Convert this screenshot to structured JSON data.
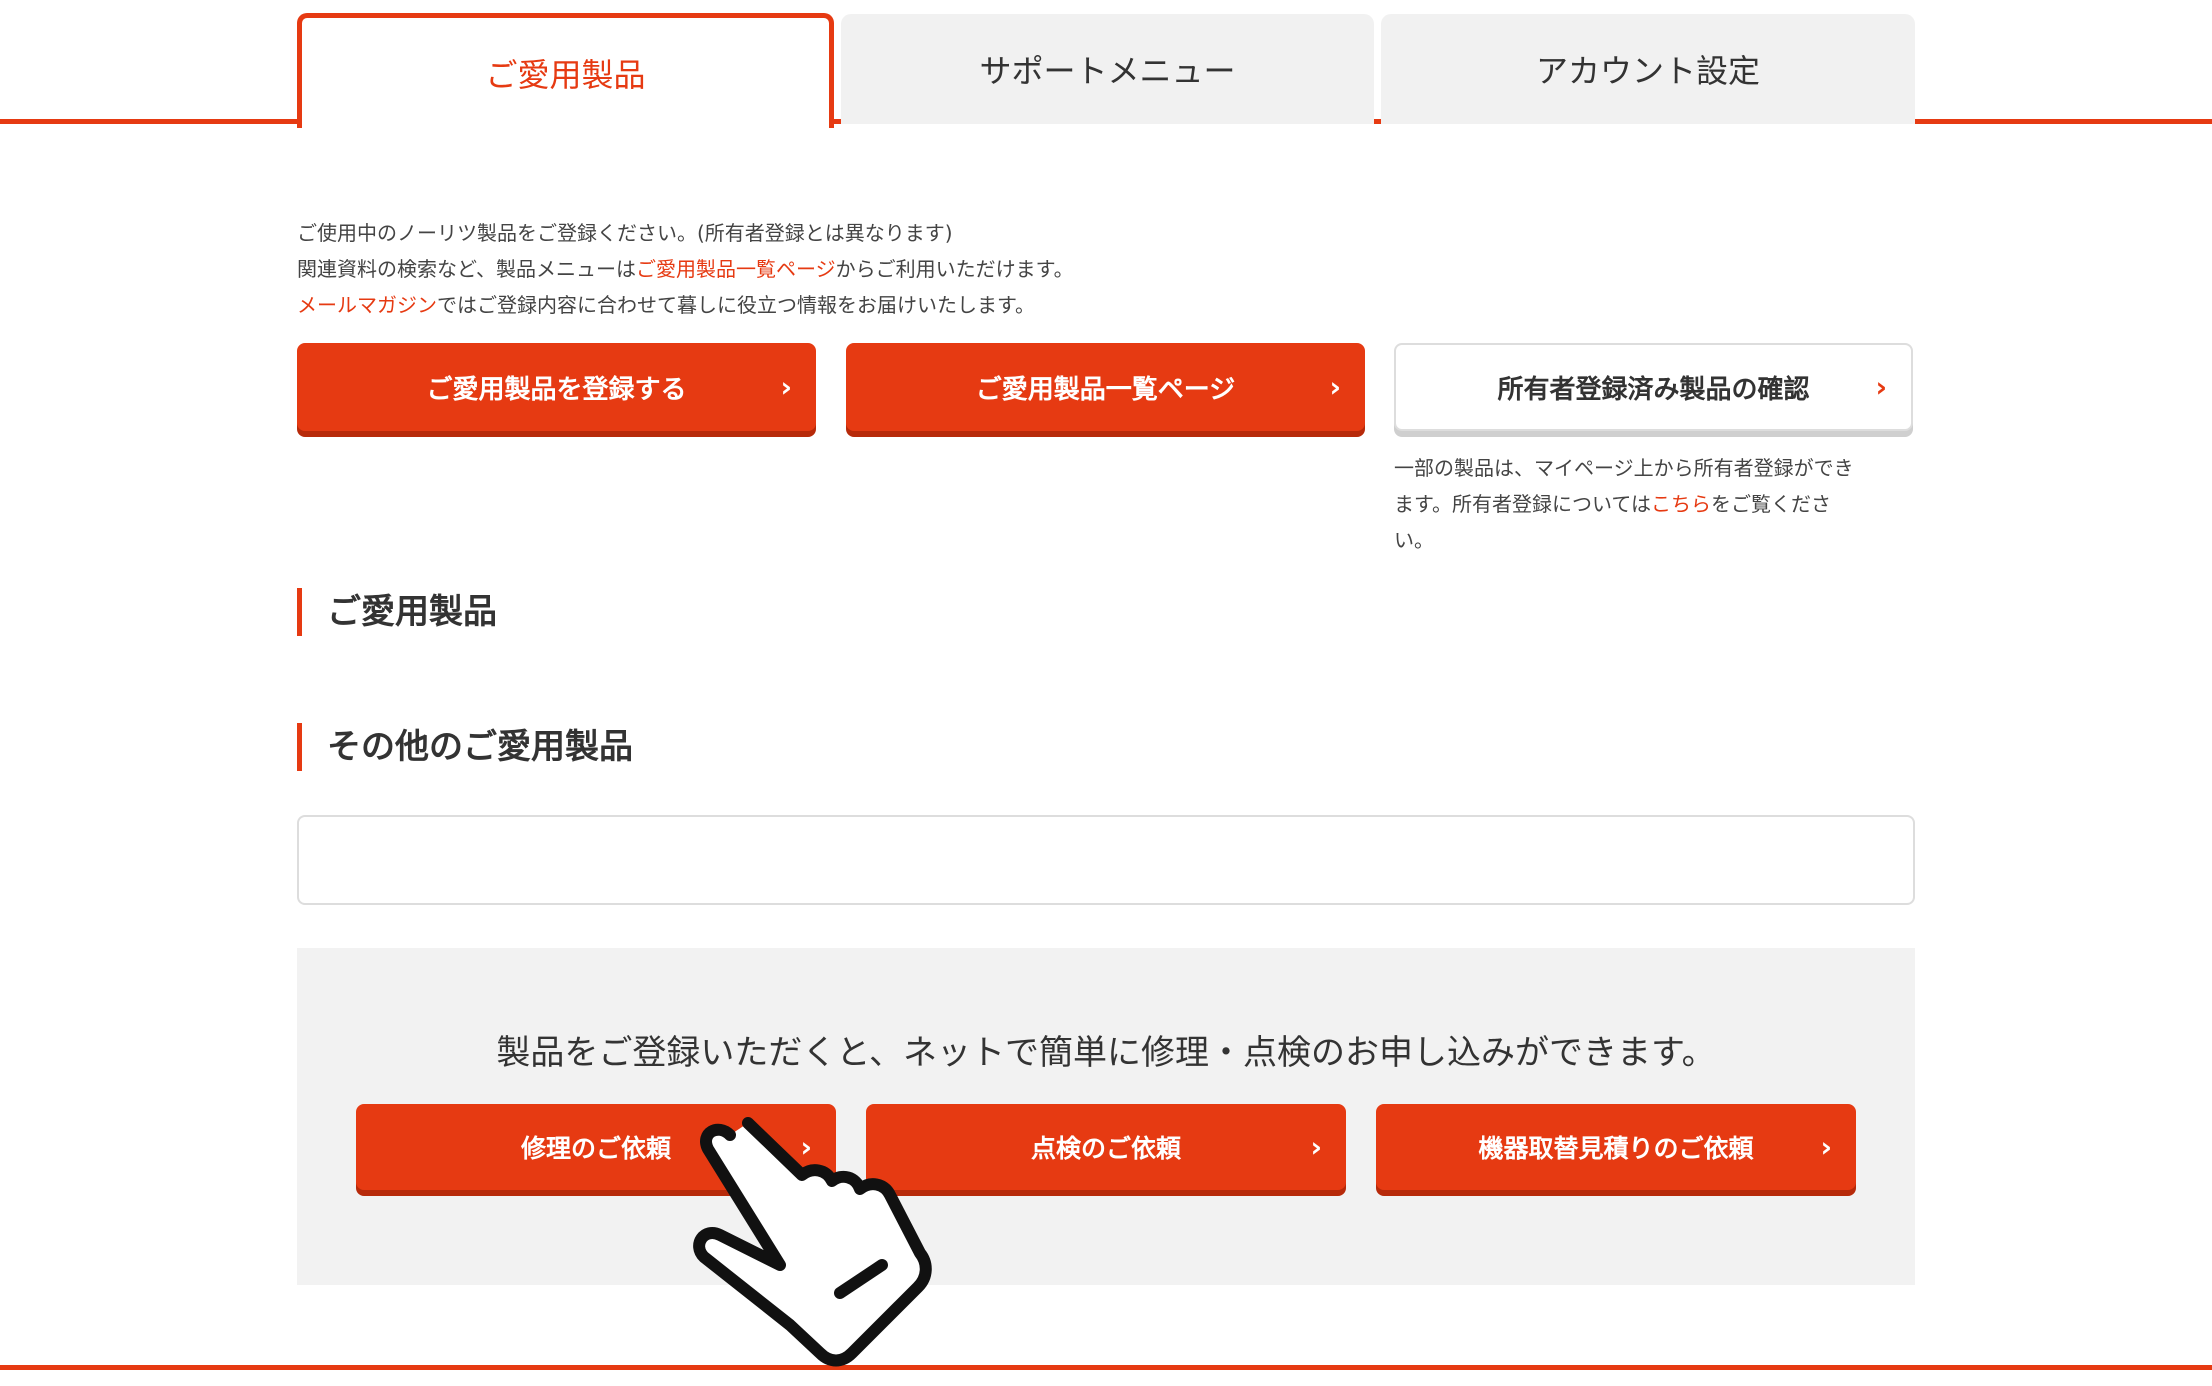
{
  "tabs": [
    {
      "label": "ご愛用製品",
      "active": true
    },
    {
      "label": "サポートメニュー",
      "active": false
    },
    {
      "label": "アカウント設定",
      "active": false
    }
  ],
  "intro": {
    "line1": "ご使用中のノーリツ製品をご登録ください。(所有者登録とは異なります)",
    "line2_pre": "関連資料の検索など、製品メニューは",
    "line2_link": "ご愛用製品一覧ページ",
    "line2_post": "からご利用いただけます。",
    "line3_link": "メールマガジン",
    "line3_post": "ではご登録内容に合わせて暮しに役立つ情報をお届けいたします。"
  },
  "buttons": {
    "register": "ご愛用製品を登録する",
    "list": "ご愛用製品一覧ページ",
    "owner_check": "所有者登録済み製品の確認",
    "chevron": "›"
  },
  "note": {
    "pre": "一部の製品は、マイページ上から所有者登録ができます。所有者登録については",
    "link": "こちら",
    "post": "をご覧ください。"
  },
  "sections": {
    "my_products": "ご愛用製品",
    "other_products": "その他のご愛用製品"
  },
  "panel": {
    "message": "製品をご登録いただくと、ネットで簡単に修理・点検のお申し込みができます。",
    "repair": "修理のご依頼",
    "inspection": "点検のご依頼",
    "replacement": "機器取替見積りのご依頼"
  },
  "colors": {
    "accent": "#e63a12",
    "panel_bg": "#f2f2f2"
  },
  "icons": {
    "cursor": "pointing-hand-cursor-icon"
  }
}
